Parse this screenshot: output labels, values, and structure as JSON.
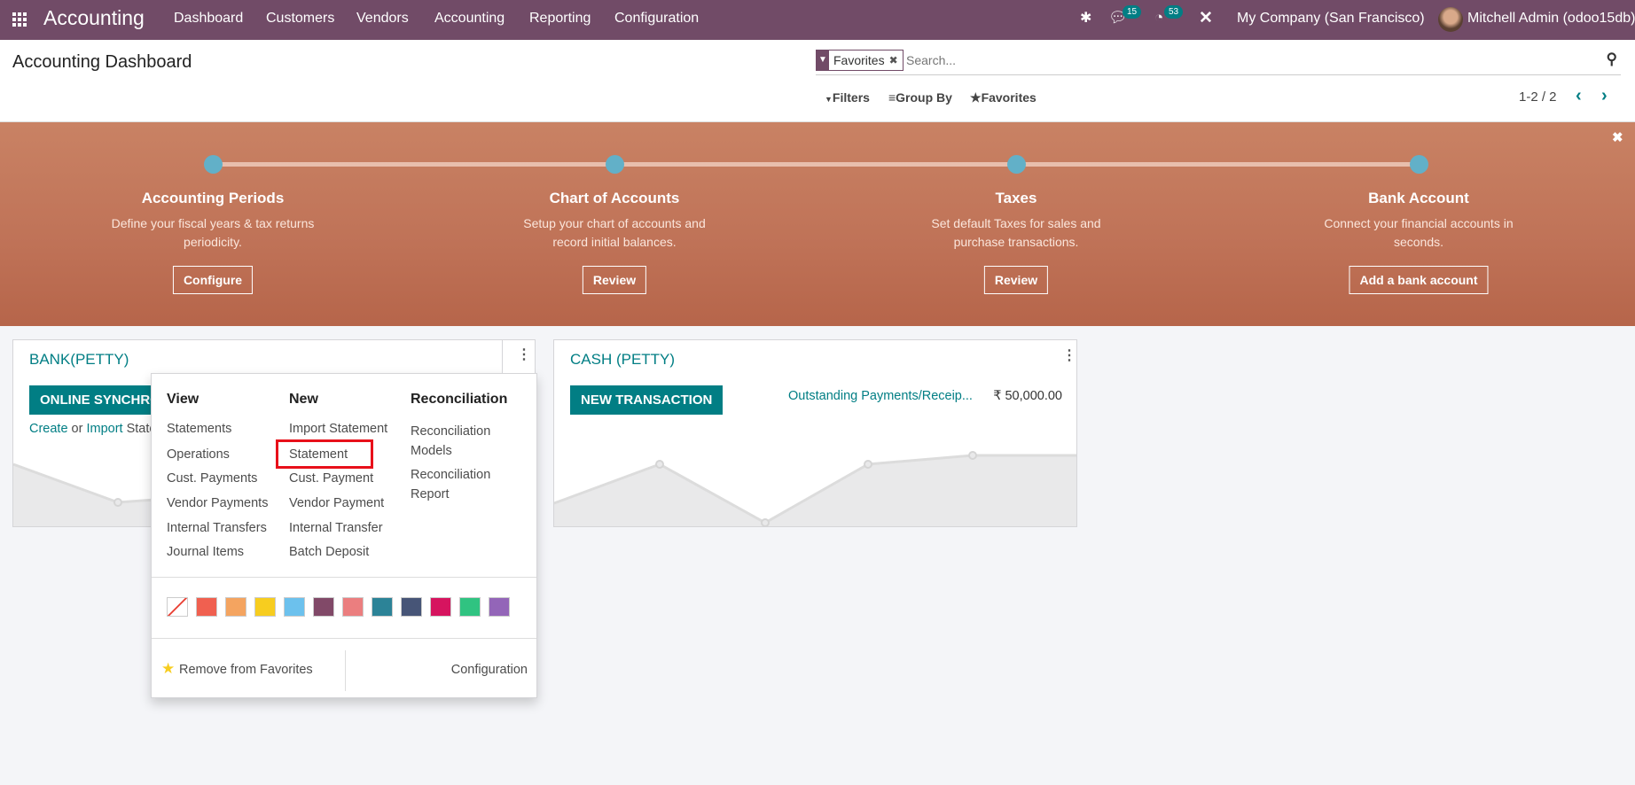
{
  "navbar": {
    "app": "Accounting",
    "menu": [
      "Dashboard",
      "Customers",
      "Vendors",
      "Accounting",
      "Reporting",
      "Configuration"
    ],
    "messages_count": "15",
    "activities_count": "53",
    "company": "My Company (San Francisco)",
    "user": "Mitchell Admin (odoo15db)",
    "color": "#714b67"
  },
  "control_panel": {
    "title": "Accounting Dashboard",
    "facet": "Favorites",
    "search_placeholder": "Search...",
    "filters": "Filters",
    "group_by": "Group By",
    "favorites": "Favorites",
    "pager": "1-2 / 2"
  },
  "onboarding": {
    "steps": [
      {
        "title": "Accounting Periods",
        "desc1": "Define your fiscal years & tax returns",
        "desc2": "periodicity.",
        "button": "Configure"
      },
      {
        "title": "Chart of Accounts",
        "desc1": "Setup your chart of accounts and",
        "desc2": "record initial balances.",
        "button": "Review"
      },
      {
        "title": "Taxes",
        "desc1": "Set default Taxes for sales and",
        "desc2": "purchase transactions.",
        "button": "Review"
      },
      {
        "title": "Bank Account",
        "desc1": "Connect your financial accounts in",
        "desc2": "seconds.",
        "button": "Add a bank account"
      }
    ]
  },
  "bank_card": {
    "title": "BANK(PETTY)",
    "button": "ONLINE SYNCHRONIZATION",
    "create": "Create",
    "or": " or ",
    "import": "Import",
    "statements": " Statements"
  },
  "cash_card": {
    "title": "CASH (PETTY)",
    "button": "NEW TRANSACTION",
    "outstanding_label": "Outstanding Payments/Receip...",
    "outstanding_value": "₹ 50,000.00"
  },
  "dropdown": {
    "view": {
      "header": "View",
      "items": [
        "Statements",
        "Operations",
        "Cust. Payments",
        "Vendor Payments",
        "Internal Transfers",
        "Journal Items"
      ]
    },
    "new": {
      "header": "New",
      "items": [
        "Import Statement",
        "Statement",
        "Cust. Payment",
        "Vendor Payment",
        "Internal Transfer",
        "Batch Deposit"
      ]
    },
    "reconciliation": {
      "header": "Reconciliation",
      "items": [
        "Reconciliation",
        "Models",
        "Reconciliation",
        "Report"
      ]
    },
    "highlighted": "Statement",
    "colors": [
      "#f06050",
      "#f4a460",
      "#f7cd1f",
      "#6cc1ed",
      "#814968",
      "#eb7e7f",
      "#2c8397",
      "#475577",
      "#d6145f",
      "#30c381",
      "#9365b8"
    ],
    "remove_favorites": "Remove from Favorites",
    "configuration": "Configuration"
  }
}
